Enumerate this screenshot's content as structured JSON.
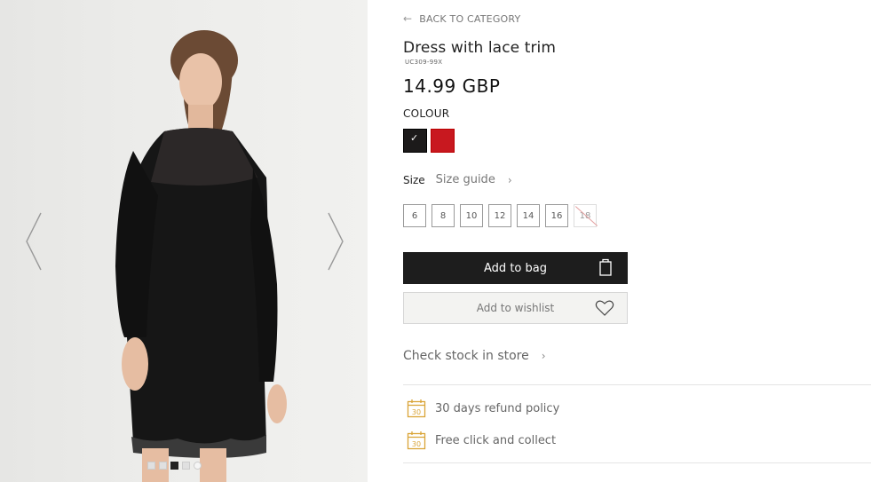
{
  "product": {
    "back_label": "BACK TO CATEGORY",
    "title": "Dress with lace trim",
    "sku": "UC309-99X",
    "price": "14.99 GBP",
    "colour_label": "COLOUR",
    "colours": [
      {
        "name": "black",
        "hex": "#1c1a1a",
        "selected": true
      },
      {
        "name": "red",
        "hex": "#c8181f",
        "selected": false
      }
    ],
    "size_label": "Size",
    "size_guide_label": "Size guide",
    "sizes": [
      "6",
      "8",
      "10",
      "12",
      "14",
      "16",
      "18"
    ],
    "unavailable_size": "18",
    "add_to_bag_label": "Add to bag",
    "add_to_wishlist_label": "Add to wishlist",
    "check_stock_label": "Check stock in store",
    "perks": [
      {
        "icon": "calendar-30-icon",
        "badge": "30",
        "label": "30 days refund policy"
      },
      {
        "icon": "calendar-30-icon",
        "badge": "30",
        "label": "Free click and collect"
      }
    ]
  },
  "gallery": {
    "image_count": 5,
    "active_index": 2
  },
  "colors": {
    "accent_dark": "#1d1d1d",
    "icon_gold": "#d9a437"
  }
}
